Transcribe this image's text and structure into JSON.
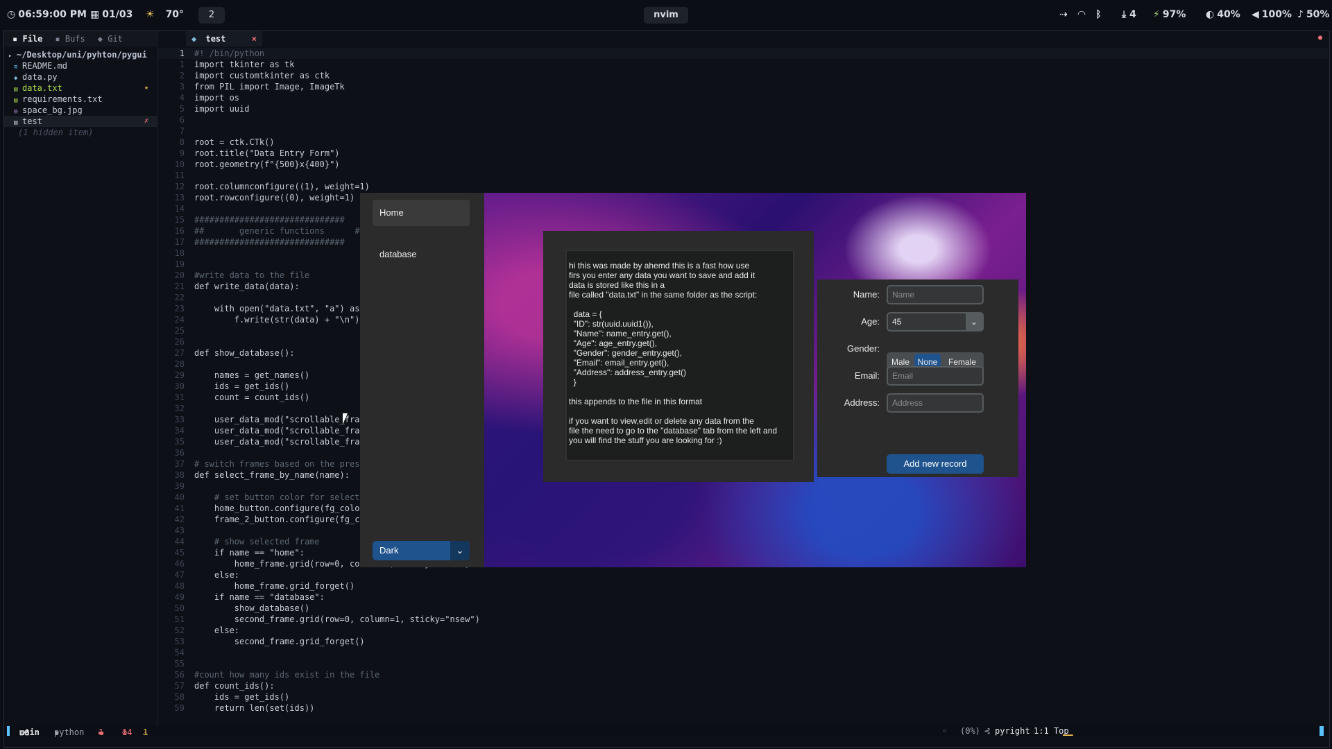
{
  "topbar": {
    "clock": "06:59:00 PM",
    "date": "01/03",
    "weather_temp": "70°",
    "workspace": "2",
    "window_title": "nvim",
    "downloads": "4",
    "battery": "97%",
    "brightness": "40%",
    "volume": "100%",
    "mic": "50%"
  },
  "tree": {
    "tabs": [
      "File",
      "Bufs",
      "Git"
    ],
    "root": "~/Desktop/uni/pyhton/pygui",
    "items": [
      {
        "name": "README.md"
      },
      {
        "name": "data.py"
      },
      {
        "name": "data.txt",
        "mark": "★"
      },
      {
        "name": "requirements.txt"
      },
      {
        "name": "space_bg.jpg"
      },
      {
        "name": "test",
        "mark": "✗"
      }
    ],
    "hidden_note": "(1 hidden item)"
  },
  "buffer_tab": {
    "name": "test",
    "close": "×"
  },
  "code_lines": [
    {
      "n": "1",
      "t": "#! /bin/python"
    },
    {
      "n": "1",
      "t": "import tkinter as tk"
    },
    {
      "n": "2",
      "t": "import customtkinter as ctk"
    },
    {
      "n": "3",
      "t": "from PIL import Image, ImageTk"
    },
    {
      "n": "4",
      "t": "import os"
    },
    {
      "n": "5",
      "t": "import uuid"
    },
    {
      "n": "6",
      "t": ""
    },
    {
      "n": "7",
      "t": ""
    },
    {
      "n": "8",
      "t": "root = ctk.CTk()"
    },
    {
      "n": "9",
      "t": "root.title(\"Data Entry Form\")"
    },
    {
      "n": "10",
      "t": "root.geometry(f\"{500}x{400}\")"
    },
    {
      "n": "11",
      "t": ""
    },
    {
      "n": "12",
      "t": "root.columnconfigure((1), weight=1)"
    },
    {
      "n": "13",
      "t": "root.rowconfigure((0), weight=1)"
    },
    {
      "n": "14",
      "t": ""
    },
    {
      "n": "15",
      "t": "##############################"
    },
    {
      "n": "16",
      "t": "##       generic functions      ##"
    },
    {
      "n": "17",
      "t": "##############################"
    },
    {
      "n": "18",
      "t": ""
    },
    {
      "n": "19",
      "t": ""
    },
    {
      "n": "20",
      "t": "#write data to the file"
    },
    {
      "n": "21",
      "t": "def write_data(data):"
    },
    {
      "n": "22",
      "t": ""
    },
    {
      "n": "23",
      "t": "    with open(\"data.txt\", \"a\") as f"
    },
    {
      "n": "24",
      "t": "        f.write(str(data) + \"\\n\")"
    },
    {
      "n": "25",
      "t": ""
    },
    {
      "n": "26",
      "t": ""
    },
    {
      "n": "27",
      "t": "def show_database():"
    },
    {
      "n": "28",
      "t": ""
    },
    {
      "n": "29",
      "t": "    names = get_names()"
    },
    {
      "n": "30",
      "t": "    ids = get_ids()"
    },
    {
      "n": "31",
      "t": "    count = count_ids()"
    },
    {
      "n": "32",
      "t": ""
    },
    {
      "n": "33",
      "t": "    user_data_mod(\"scrollable_frame"
    },
    {
      "n": "34",
      "t": "    user_data_mod(\"scrollable_frame\""
    },
    {
      "n": "35",
      "t": "    user_data_mod(\"scrollable_frame"
    },
    {
      "n": "36",
      "t": ""
    },
    {
      "n": "37",
      "t": "# switch frames based on the pressed"
    },
    {
      "n": "38",
      "t": "def select_frame_by_name(name):"
    },
    {
      "n": "39",
      "t": ""
    },
    {
      "n": "40",
      "t": "    # set button color for selected"
    },
    {
      "n": "41",
      "t": "    home_button.configure(fg_color="
    },
    {
      "n": "42",
      "t": "    frame_2_button.configure(fg_colo"
    },
    {
      "n": "43",
      "t": ""
    },
    {
      "n": "44",
      "t": "    # show selected frame"
    },
    {
      "n": "45",
      "t": "    if name == \"home\":"
    },
    {
      "n": "46",
      "t": "        home_frame.grid(row=0, column=1, sticky=\"nsew\")"
    },
    {
      "n": "47",
      "t": "    else:"
    },
    {
      "n": "48",
      "t": "        home_frame.grid_forget()"
    },
    {
      "n": "49",
      "t": "    if name == \"database\":"
    },
    {
      "n": "50",
      "t": "        show_database()"
    },
    {
      "n": "51",
      "t": "        second_frame.grid(row=0, column=1, sticky=\"nsew\")"
    },
    {
      "n": "52",
      "t": "    else:"
    },
    {
      "n": "53",
      "t": "        second_frame.grid_forget()"
    },
    {
      "n": "54",
      "t": ""
    },
    {
      "n": "55",
      "t": ""
    },
    {
      "n": "56",
      "t": "#count how many ids exist in the file"
    },
    {
      "n": "57",
      "t": "def count_ids():"
    },
    {
      "n": "58",
      "t": "    ids = get_ids()"
    },
    {
      "n": "59",
      "t": "    return len(set(ids))"
    }
  ],
  "statusline": {
    "branch": "main",
    "filetype": "python",
    "errors_badge": "1",
    "diag_errors": "14",
    "diag_warnings": "1",
    "percent": "(0%)",
    "lsp": "pyright",
    "position": "1:1 Top"
  },
  "app": {
    "nav_home": "Home",
    "nav_database": "database",
    "theme_value": "Dark",
    "info_lines": [
      "hi this was made by ahemd this is a fast how use",
      "firs you enter any data you want to save and add it",
      "data is stored like this in a",
      "file called \"data.txt\" in the same folder as the script:",
      "",
      "  data = {",
      "  \"ID\": str(uuid.uuid1()),",
      "  \"Name\": name_entry.get(),",
      "  \"Age\": age_entry.get(),",
      "  \"Gender\": gender_entry.get(),",
      "  \"Email\": email_entry.get(),",
      "  \"Address\": address_entry.get()",
      "  }",
      "",
      "this appends to the file in this format",
      "",
      "if you want to view,edit or delete any data from the",
      "file the need to go to the \"database\" tab from the left and",
      "you will find the stuff you are looking for :)"
    ],
    "form": {
      "name_label": "Name:",
      "name_placeholder": "Name",
      "age_label": "Age:",
      "age_value": "45",
      "gender_label": "Gender:",
      "gender_options": [
        "Male",
        "None",
        "Female"
      ],
      "gender_selected": "None",
      "email_label": "Email:",
      "email_placeholder": "Email",
      "address_label": "Address:",
      "address_placeholder": "Address",
      "add_button": "Add new record"
    }
  },
  "colors": {
    "accent": "#1f538d",
    "selected_segment": "#1f538d"
  }
}
